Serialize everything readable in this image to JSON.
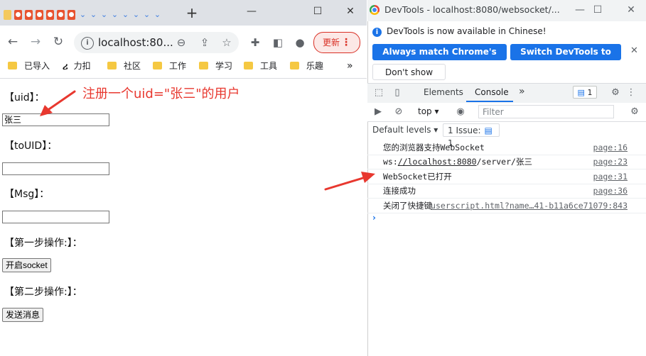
{
  "browser": {
    "tab_close": "⌄",
    "new_tab": "+",
    "window_controls": [
      "—",
      "☐",
      "✕"
    ],
    "url": "localhost:80...",
    "update_label": "更新",
    "update_more": "⋮",
    "bookmarks": [
      "已导入",
      "力扣",
      "社区",
      "工作",
      "学习",
      "工具",
      "乐趣"
    ],
    "bookmarks_more": "»"
  },
  "page": {
    "uid_label": "【uid】：",
    "uid_value": "张三",
    "touid_label": "【toUID】：",
    "touid_value": "",
    "msg_label": "【Msg】：",
    "msg_value": "",
    "step1_label": "【第一步操作:】：",
    "open_socket_button": "开启socket",
    "step2_label": "【第二步操作:】：",
    "send_button": "发送消息",
    "annotation": "注册一个uid=\"张三\"的用户"
  },
  "devtools": {
    "title": "DevTools - localhost:8080/websocket/...",
    "info_text": "DevTools is now available in Chinese!",
    "match_language_button": "Always match Chrome's language",
    "switch_chinese_button": "Switch DevTools to Chinese",
    "dont_show_button": "Don't show again",
    "tabs": [
      "Elements",
      "Console"
    ],
    "active_tab": "Console",
    "more_tabs": "»",
    "message_count": "1",
    "context": "top",
    "filter_placeholder": "Filter",
    "default_levels": "Default levels",
    "issue_text": "1 Issue:",
    "issue_count": "1",
    "logs": [
      {
        "message": "您的浏览器支持WebSocket",
        "source": "page:16"
      },
      {
        "message_prefix": "ws:",
        "message_link": "//localhost:8080",
        "message_suffix": "/server/张三",
        "source": "page:23"
      },
      {
        "message": "WebSocket已打开",
        "source": "page:31"
      },
      {
        "message": "连接成功",
        "source": "page:36"
      },
      {
        "message": "关闭了快捷键",
        "source": "userscript.html?name…41-b11a6ce71079:843"
      }
    ],
    "prompt": "›"
  },
  "colors": {
    "annotation_red": "#e8382f",
    "devtools_blue": "#1a73e8",
    "update_red": "#d93025"
  }
}
